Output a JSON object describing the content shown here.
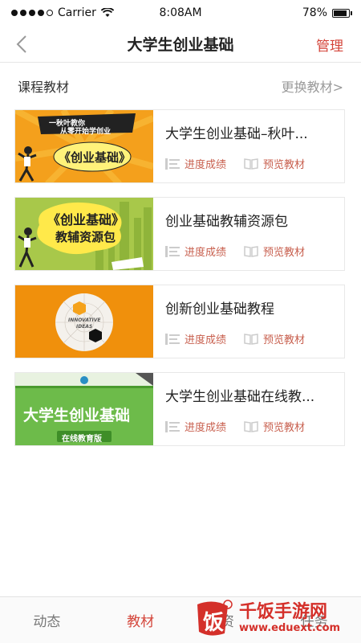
{
  "status": {
    "carrier": "Carrier",
    "time": "8:08AM",
    "battery": "78%",
    "battery_level": 0.78
  },
  "nav": {
    "title": "大学生创业基础",
    "manage": "管理"
  },
  "section": {
    "title": "课程教材",
    "change": "更换教材>"
  },
  "courses": [
    {
      "title": "大学生创业基础–秋叶...",
      "thumb_text_1": "一秋叶教你",
      "thumb_text_2": "从零开始学创业",
      "thumb_text_3": "《创业基础》",
      "progress": "进度成绩",
      "preview": "预览教材"
    },
    {
      "title": "创业基础教辅资源包",
      "thumb_text_1": "《创业基础》",
      "thumb_text_2": "教辅资源包",
      "progress": "进度成绩",
      "preview": "预览教材"
    },
    {
      "title": "创新创业基础教程",
      "thumb_text_1": "INNOVATIVE",
      "thumb_text_2": "IDEAS",
      "progress": "进度成绩",
      "preview": "预览教材"
    },
    {
      "title": "大学生创业基础在线教...",
      "thumb_text_1": "大学生创业基础",
      "thumb_text_2": "在线教育版",
      "progress": "进度成绩",
      "preview": "预览教材"
    }
  ],
  "tabs": [
    "动态",
    "教材",
    "资",
    "任务"
  ],
  "watermark": {
    "title": "千饭手游网",
    "url": "www.eduext.com",
    "logo_char": "饭"
  },
  "colors": {
    "accent": "#d4453a",
    "action": "#c8604f"
  }
}
